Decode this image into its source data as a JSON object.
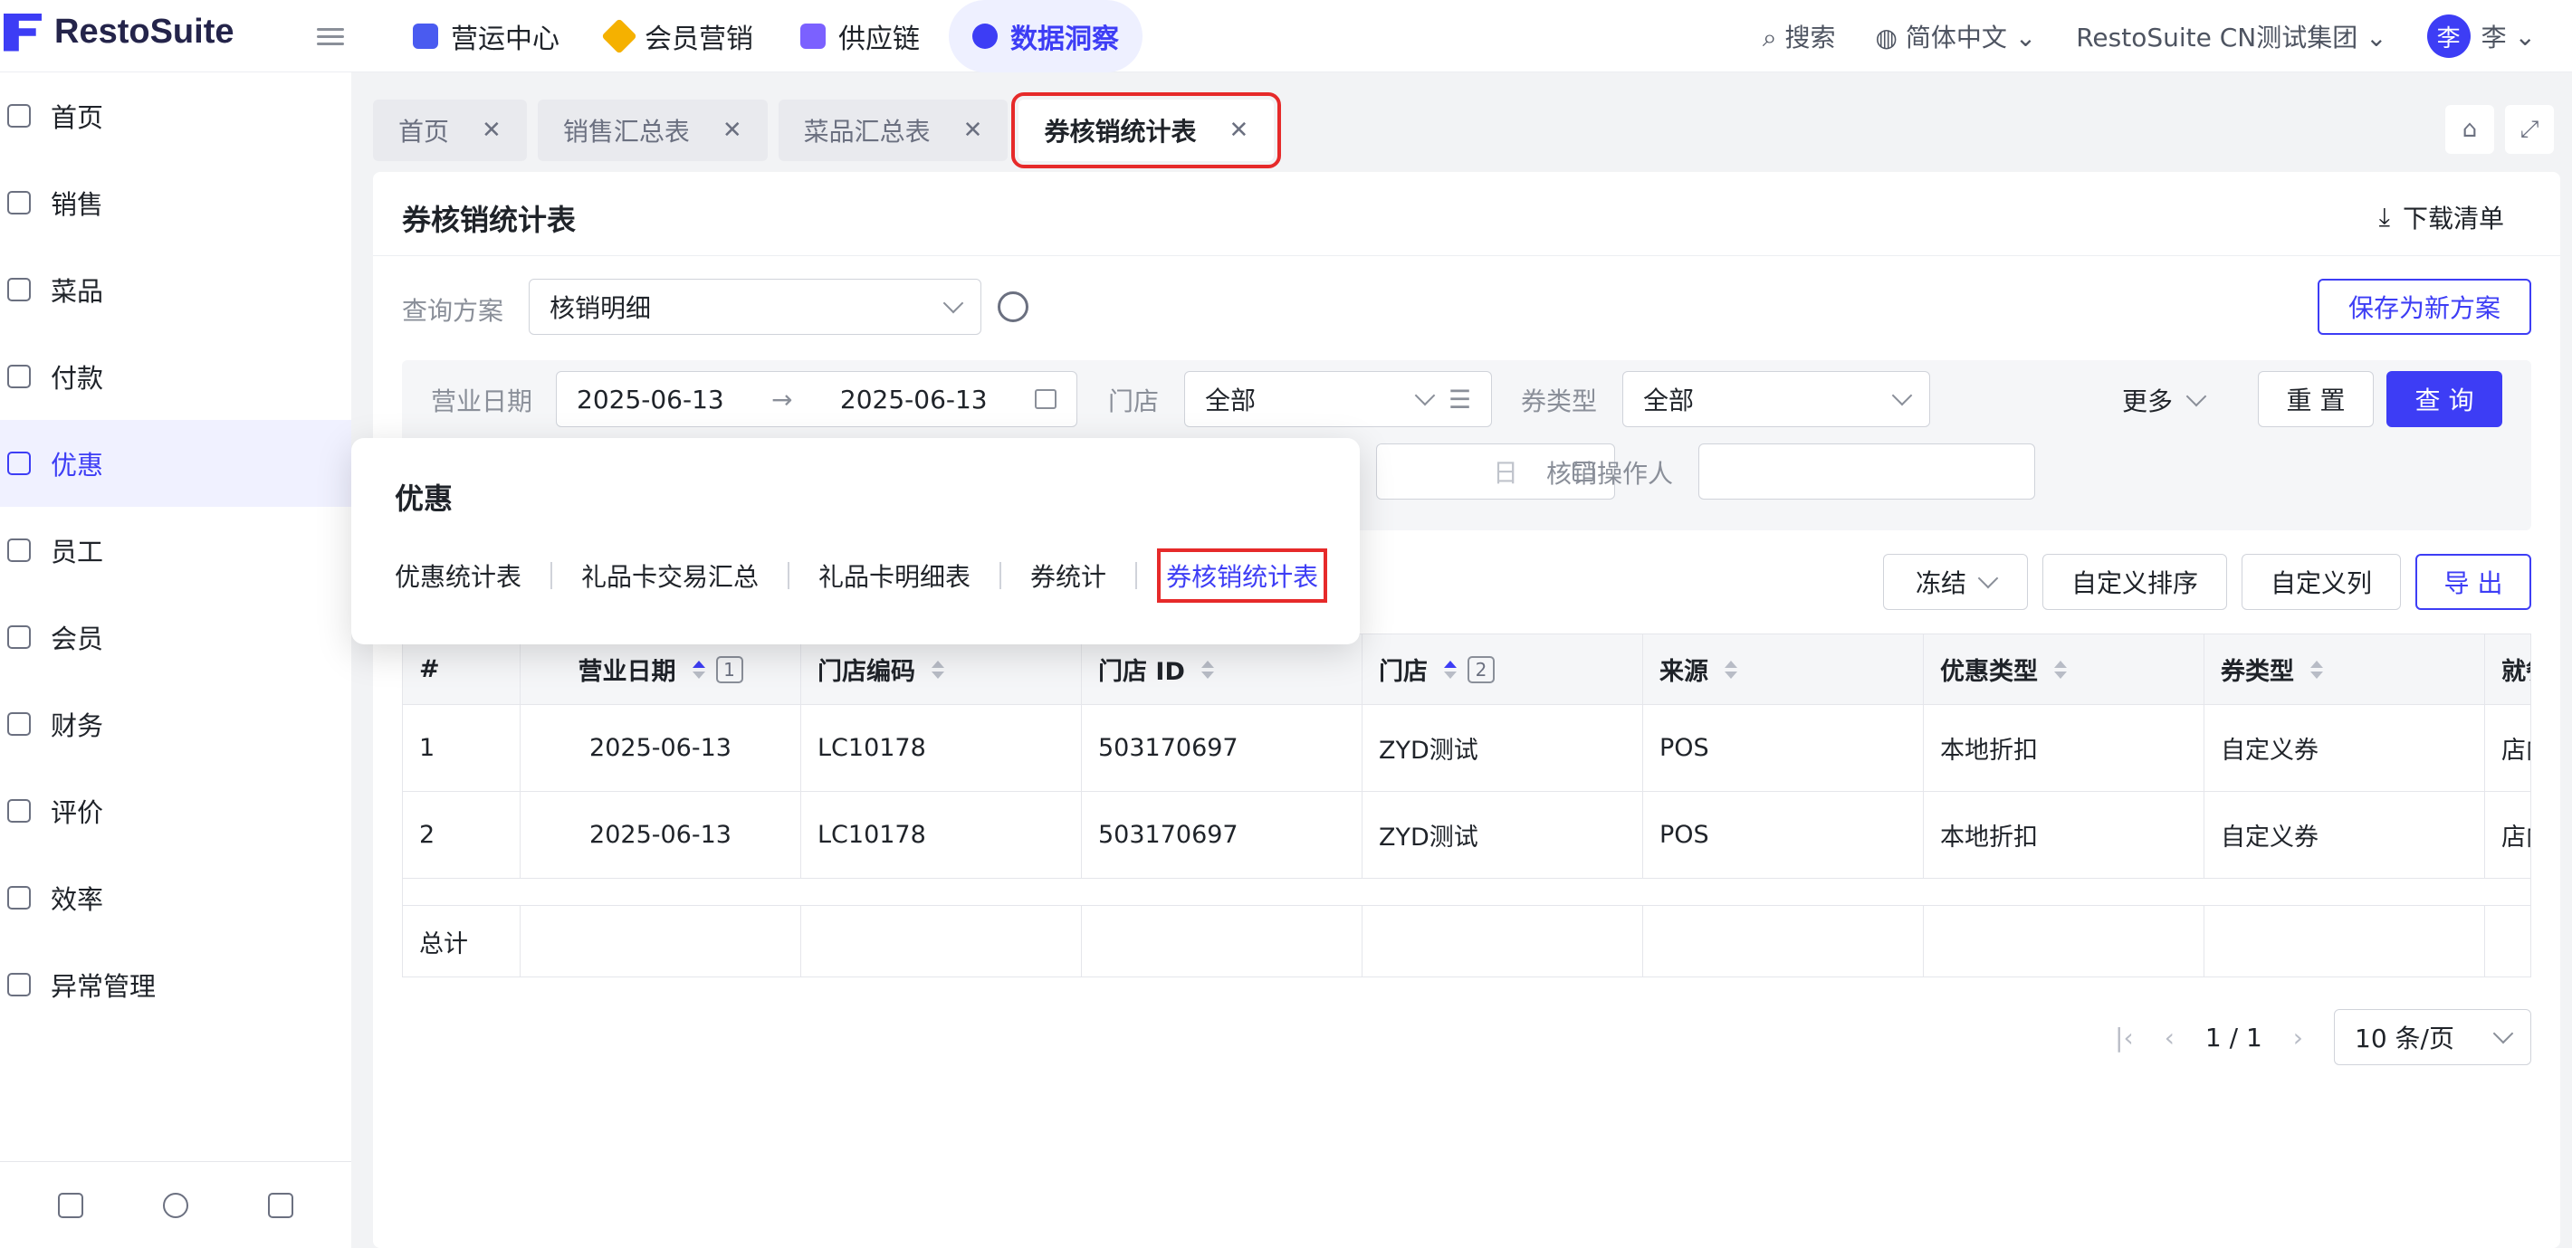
{
  "brand": {
    "name": "RestoSuite"
  },
  "topnav": {
    "items": [
      {
        "label": "营运中心",
        "icon": "operations-icon",
        "color": "#4a5bf0"
      },
      {
        "label": "会员营销",
        "icon": "member-marketing-icon",
        "color": "#f5b100"
      },
      {
        "label": "供应链",
        "icon": "supply-chain-icon",
        "color": "#7b61ff"
      },
      {
        "label": "数据洞察",
        "icon": "data-insight-icon",
        "color": "#3d3df5",
        "active": true
      }
    ],
    "search": "搜索",
    "language": "简体中文",
    "org": "RestoSuite CN测试集团",
    "user_avatar": "李",
    "user_name": "李"
  },
  "sidebar": {
    "items": [
      {
        "label": "首页",
        "icon": "home-icon"
      },
      {
        "label": "销售",
        "icon": "sales-icon"
      },
      {
        "label": "菜品",
        "icon": "dish-icon"
      },
      {
        "label": "付款",
        "icon": "payment-icon"
      },
      {
        "label": "优惠",
        "icon": "discount-icon",
        "active": true
      },
      {
        "label": "员工",
        "icon": "staff-icon"
      },
      {
        "label": "会员",
        "icon": "member-icon"
      },
      {
        "label": "财务",
        "icon": "finance-icon"
      },
      {
        "label": "评价",
        "icon": "review-icon"
      },
      {
        "label": "效率",
        "icon": "efficiency-icon"
      },
      {
        "label": "异常管理",
        "icon": "exception-icon"
      }
    ]
  },
  "tabs": [
    {
      "label": "首页"
    },
    {
      "label": "销售汇总表"
    },
    {
      "label": "菜品汇总表"
    },
    {
      "label": "券核销统计表",
      "active": true
    }
  ],
  "page": {
    "title": "券核销统计表",
    "download": "下载清单",
    "scheme_label": "查询方案",
    "scheme_value": "核销明细",
    "save_new": "保存为新方案"
  },
  "filters": {
    "date_label": "营业日期",
    "date_start": "2025-06-13",
    "date_sep": "→",
    "date_end": "2025-06-13",
    "store_label": "门店",
    "store_value": "全部",
    "coupon_type_label": "券类型",
    "coupon_type_value": "全部",
    "more": "更多",
    "reset": "重 置",
    "query": "查 询",
    "partial_placeholder": "日",
    "operator_label": "核销操作人",
    "operator_value": ""
  },
  "toolbar": {
    "freeze": "冻结",
    "custom_sort": "自定义排序",
    "custom_cols": "自定义列",
    "export": "导 出"
  },
  "table": {
    "headers": [
      "#",
      "营业日期",
      "门店编码",
      "门店 ID",
      "门店",
      "来源",
      "优惠类型",
      "券类型",
      "就餐"
    ],
    "sort_order": {
      "date": "1",
      "store": "2"
    },
    "rows": [
      [
        "1",
        "2025-06-13",
        "LC10178",
        "503170697",
        "ZYD测试",
        "POS",
        "本地折扣",
        "自定义券",
        "店内"
      ],
      [
        "2",
        "2025-06-13",
        "LC10178",
        "503170697",
        "ZYD测试",
        "POS",
        "本地折扣",
        "自定义券",
        "店内"
      ]
    ],
    "total_label": "总计"
  },
  "pagination": {
    "current": "1",
    "slash": "/",
    "total": "1",
    "page_size": "10 条/页"
  },
  "popup": {
    "title": "优惠",
    "links": [
      "优惠统计表",
      "礼品卡交易汇总",
      "礼品卡明细表",
      "券统计",
      "券核销统计表"
    ],
    "active_index": 4
  }
}
